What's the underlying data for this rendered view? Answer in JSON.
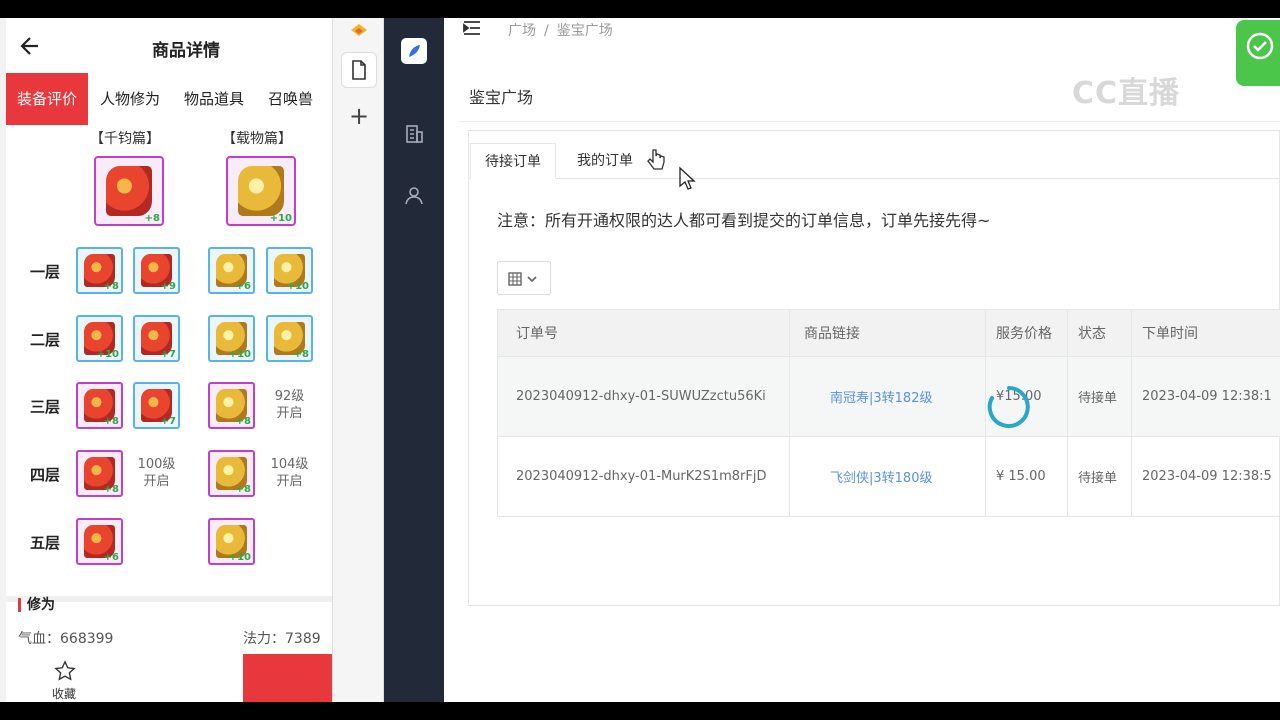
{
  "phone": {
    "title": "商品详情",
    "tabs": [
      "装备评价",
      "人物修为",
      "物品道具",
      "召唤兽"
    ],
    "sections": [
      "【千钧篇】",
      "【载物篇】"
    ],
    "big_slots": [
      {
        "color": "red",
        "plus": "+8"
      },
      {
        "color": "gold",
        "plus": "+10"
      }
    ],
    "rows": [
      {
        "label": "一层",
        "left": [
          {
            "c": "red",
            "b": "blue",
            "p": "+8"
          },
          {
            "c": "red",
            "b": "blue",
            "p": "+9"
          }
        ],
        "right": [
          {
            "c": "gold",
            "b": "blue",
            "p": "+6"
          },
          {
            "c": "gold",
            "b": "blue",
            "p": "+10"
          }
        ]
      },
      {
        "label": "二层",
        "left": [
          {
            "c": "red",
            "b": "blue",
            "p": "+10"
          },
          {
            "c": "red",
            "b": "blue",
            "p": "+7"
          }
        ],
        "right": [
          {
            "c": "gold",
            "b": "blue",
            "p": "+10"
          },
          {
            "c": "gold",
            "b": "blue",
            "p": "+8"
          }
        ]
      },
      {
        "label": "三层",
        "left": [
          {
            "c": "red",
            "b": "purple",
            "p": "+8"
          },
          {
            "c": "red",
            "b": "blue",
            "p": "+7"
          }
        ],
        "right": [
          {
            "c": "gold",
            "b": "purple",
            "p": "+8"
          },
          {
            "locked": [
              "92级",
              "开启"
            ]
          }
        ]
      },
      {
        "label": "四层",
        "left": [
          {
            "c": "red",
            "b": "purple",
            "p": "+8"
          },
          {
            "locked": [
              "100级",
              "开启"
            ]
          }
        ],
        "right": [
          {
            "c": "gold",
            "b": "purple",
            "p": "+8"
          },
          {
            "locked": [
              "104级",
              "开启"
            ]
          }
        ]
      },
      {
        "label": "五层",
        "left": [
          {
            "c": "red",
            "b": "purple",
            "p": "+6"
          }
        ],
        "right": [
          {
            "c": "gold",
            "b": "purple",
            "p": "+10"
          }
        ]
      }
    ],
    "xiuwei_label": "修为",
    "qixue": "气血：668399",
    "fali": "法力：7389",
    "fav_label": "收藏"
  },
  "admin": {
    "breadcrumb": [
      "广场",
      "鉴宝广场"
    ],
    "page_title": "鉴宝广场",
    "watermark": "CC直播",
    "tabs": [
      "待接订单",
      "我的订单"
    ],
    "notice": "注意：所有开通权限的达人都可看到提交的订单信息，订单先接先得~",
    "table": {
      "headers": [
        "订单号",
        "商品链接",
        "服务价格",
        "状态",
        "下单时间"
      ],
      "rows": [
        {
          "order_no": "2023040912-dhxy-01-SUWUZzctu56Ki",
          "link": "南冠寿|3转182级",
          "price": "¥15.00",
          "status": "待接单",
          "time": "2023-04-09 12:38:1"
        },
        {
          "order_no": "2023040912-dhxy-01-MurK2S1m8rFjD",
          "link": "飞剑侠|3转180级",
          "price": "¥ 15.00",
          "status": "待接单",
          "time": "2023-04-09 12:38:5"
        }
      ]
    }
  },
  "colors": {
    "accent_red": "#e8383d",
    "link_blue": "#5a8fe8",
    "sidebar": "#222a3a",
    "success": "#4cc64a"
  }
}
